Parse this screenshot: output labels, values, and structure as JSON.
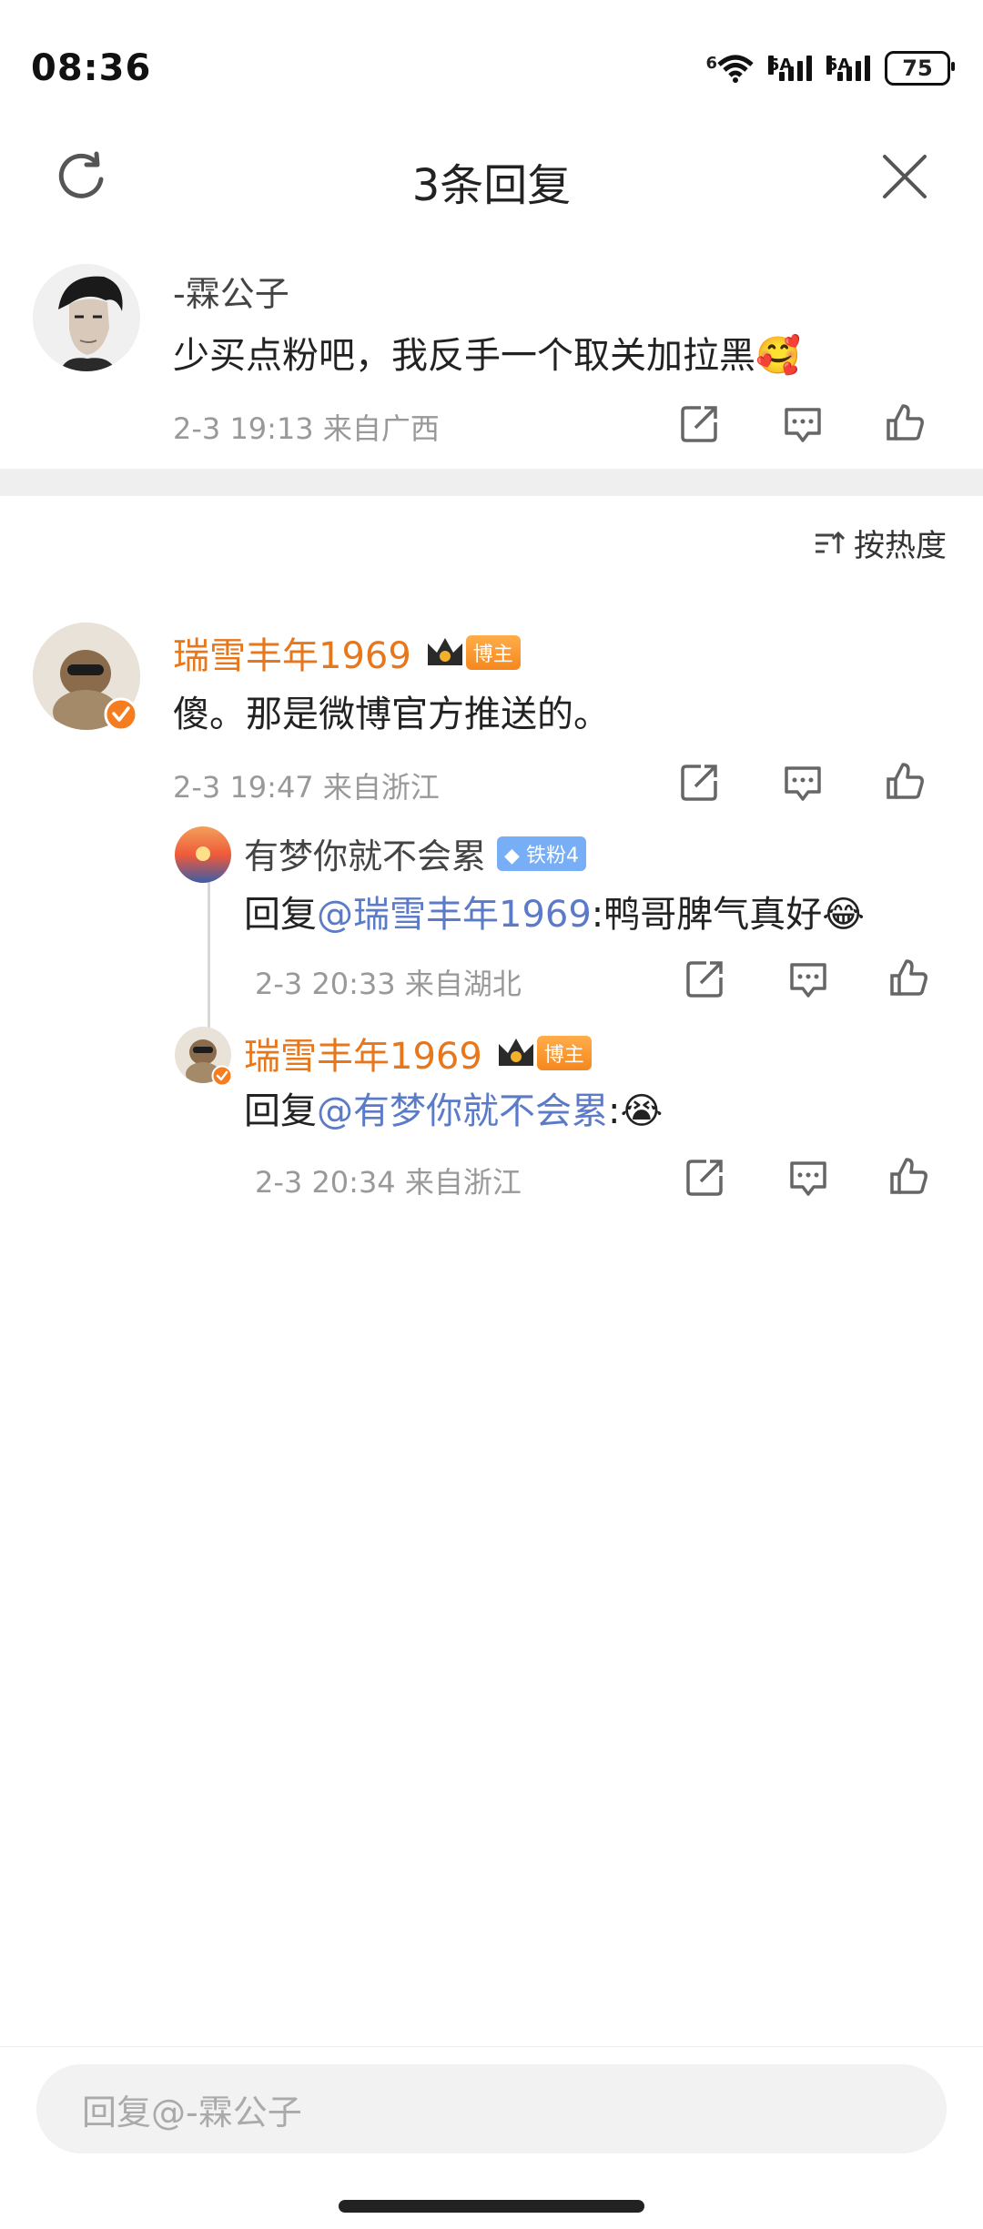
{
  "status_bar": {
    "time": "08:36",
    "battery": "75",
    "net1": "6",
    "sig1": "5A",
    "sig2": "5A"
  },
  "header": {
    "title": "3条回复"
  },
  "root_comment": {
    "author": "-霖公子",
    "text": "少买点粉吧，我反手一个取关加拉黑",
    "emoji": "🥰",
    "meta": "2-3 19:13 来自广西"
  },
  "sort": {
    "label": "按热度"
  },
  "replies": [
    {
      "author": "瑞雪丰年1969",
      "badge": "博主",
      "text": "傻。那是微博官方推送的。",
      "meta": "2-3 19:47 来自浙江"
    },
    {
      "author": "有梦你就不会累",
      "badge": "铁粉4",
      "prefix": "回复",
      "mention": "@瑞雪丰年1969",
      "text": ":鸭哥脾气真好",
      "emoji": "😂",
      "meta": "2-3 20:33 来自湖北"
    },
    {
      "author": "瑞雪丰年1969",
      "badge": "博主",
      "prefix": "回复",
      "mention": "@有梦你就不会累",
      "text": ":",
      "emoji": "😭",
      "meta": "2-3 20:34 来自浙江"
    }
  ],
  "reply_input": {
    "placeholder": "回复@-霖公子"
  }
}
